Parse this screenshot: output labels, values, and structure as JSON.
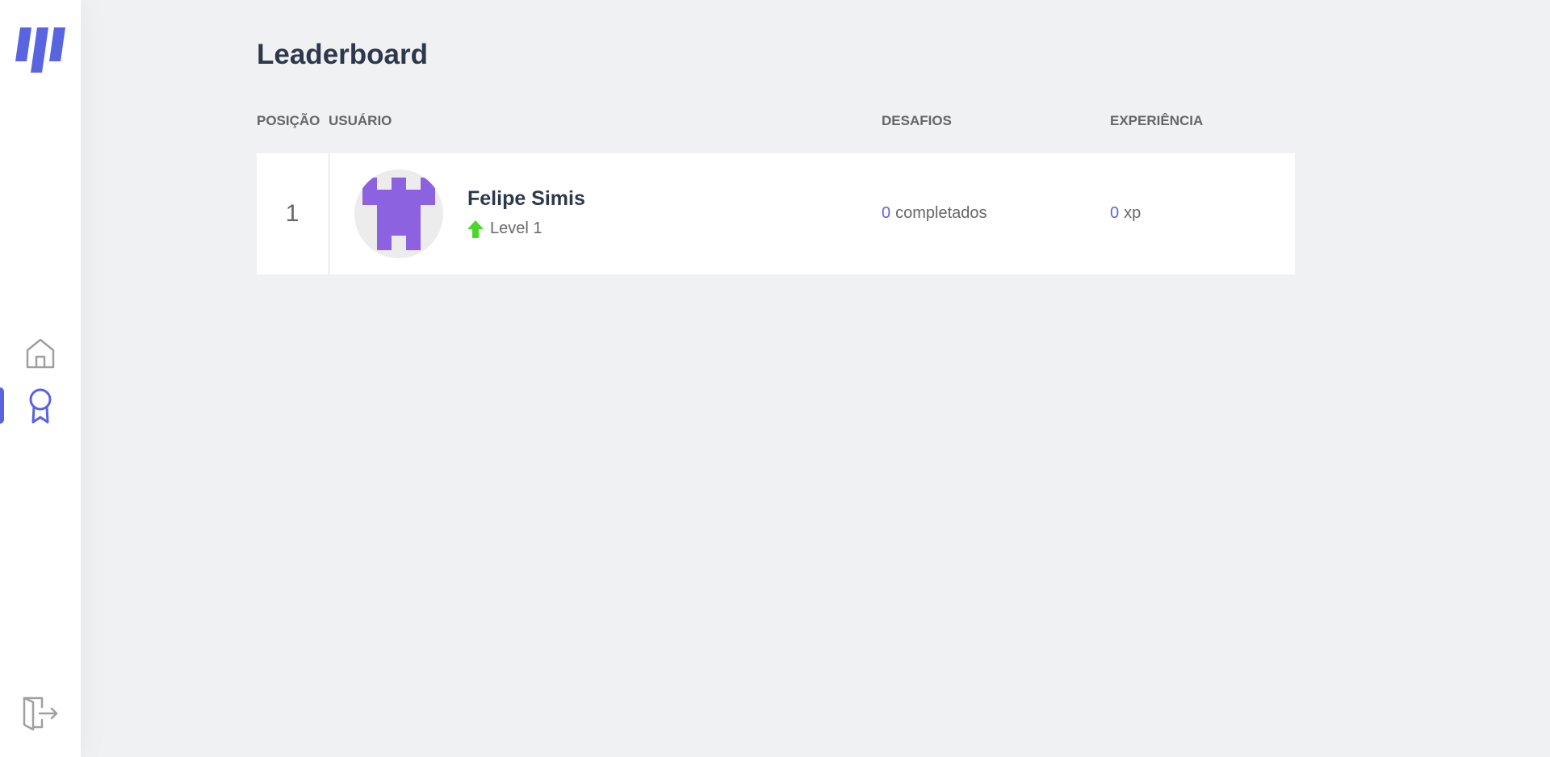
{
  "page": {
    "title": "Leaderboard"
  },
  "colors": {
    "accent": "#5965e0",
    "level_up": "#4cd62b",
    "background": "#f0f1f3"
  },
  "sidebar": {
    "items": [
      {
        "icon": "home-icon",
        "active": false
      },
      {
        "icon": "award-icon",
        "active": true
      },
      {
        "icon": "logout-icon",
        "active": false
      }
    ]
  },
  "table": {
    "headers": {
      "position": "POSIÇÃO",
      "user": "USUÁRIO",
      "challenges": "DESAFIOS",
      "experience": "EXPERIÊNCIA"
    },
    "rows": [
      {
        "position": "1",
        "name": "Felipe Simis",
        "level": "Level 1",
        "challenges_count": "0",
        "challenges_suffix": "completados",
        "xp_count": "0",
        "xp_suffix": "xp"
      }
    ]
  }
}
